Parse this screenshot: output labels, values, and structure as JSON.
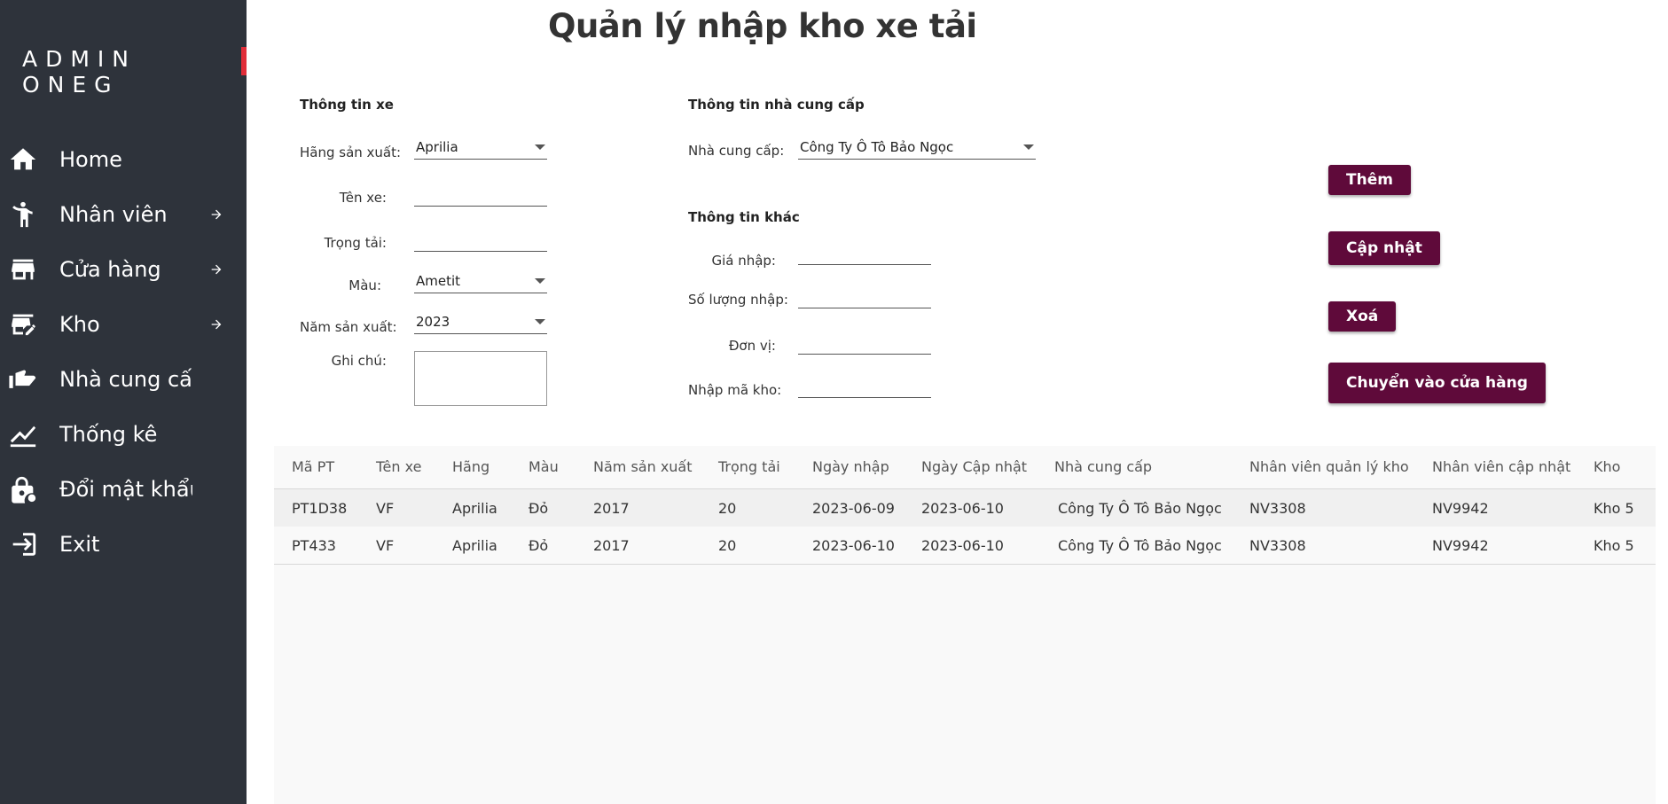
{
  "sidebar": {
    "brand": "ADMIN  ONEG",
    "items": [
      {
        "label": "Home",
        "icon": "home-icon",
        "has_arrow": false
      },
      {
        "label": "Nhân viên",
        "icon": "person-icon",
        "has_arrow": true
      },
      {
        "label": "Cửa hàng",
        "icon": "store-icon",
        "has_arrow": true
      },
      {
        "label": "Kho",
        "icon": "warehouse-edit-icon",
        "has_arrow": true
      },
      {
        "label": "Nhà cung cấp",
        "icon": "hand-icon",
        "has_arrow": false
      },
      {
        "label": "Thống kê",
        "icon": "chart-icon",
        "has_arrow": false
      },
      {
        "label": "Đổi mật khẩu",
        "icon": "lock-icon",
        "has_arrow": false
      },
      {
        "label": "Exit",
        "icon": "exit-icon",
        "has_arrow": false
      }
    ]
  },
  "page": {
    "title": "Quản lý nhập kho xe tải"
  },
  "vehicle_info": {
    "title": "Thông tin xe",
    "manufacturer_label": "Hãng sản xuất:",
    "manufacturer_value": "Aprilia",
    "name_label": "Tên xe:",
    "name_value": "",
    "load_label": "Trọng tải:",
    "load_value": "",
    "color_label": "Màu:",
    "color_value": "Ametit",
    "year_label": "Năm sản xuất:",
    "year_value": "2023",
    "note_label": "Ghi chú:",
    "note_value": ""
  },
  "supplier_info": {
    "title": "Thông tin nhà cung cấp",
    "supplier_label": "Nhà cung cấp:",
    "supplier_value": "Công Ty  Ô Tô Bảo Ngọc"
  },
  "other_info": {
    "title": "Thông tin khác",
    "price_label": "Giá nhập:",
    "price_value": "",
    "quantity_label": "Số lượng nhập:",
    "quantity_value": "",
    "unit_label": "Đơn vị:",
    "unit_value": "",
    "warehouse_label": "Nhập mã kho:",
    "warehouse_value": ""
  },
  "actions": {
    "add": "Thêm",
    "update": "Cập nhật",
    "delete": "Xoá",
    "move_to_store": "Chuyển vào cửa hàng"
  },
  "table": {
    "columns": [
      "Mã PT",
      "Tên xe",
      "Hãng",
      "Màu",
      "Năm sản xuất",
      "Trọng tải",
      "Ngày nhập",
      "Ngày Cập nhật",
      "Nhà cung cấp",
      "Nhân viên quản lý kho",
      "Nhân viên cập nhật",
      "Kho"
    ],
    "rows": [
      [
        "PT1D38",
        "VF",
        "Aprilia",
        "Đỏ",
        "2017",
        "20",
        "2023-06-09",
        "2023-06-10",
        "Công Ty  Ô Tô Bảo Ngọc",
        "NV3308",
        "NV9942",
        "Kho 5"
      ],
      [
        "PT433",
        "VF",
        "Aprilia",
        "Đỏ",
        "2017",
        "20",
        "2023-06-10",
        "2023-06-10",
        "Công Ty  Ô Tô Bảo Ngọc",
        "NV3308",
        "NV9942",
        "Kho 5"
      ]
    ]
  },
  "colors": {
    "sidebar_bg": "#2e333b",
    "accent_red": "#e12d39",
    "button_bg": "#5f0a3a"
  }
}
